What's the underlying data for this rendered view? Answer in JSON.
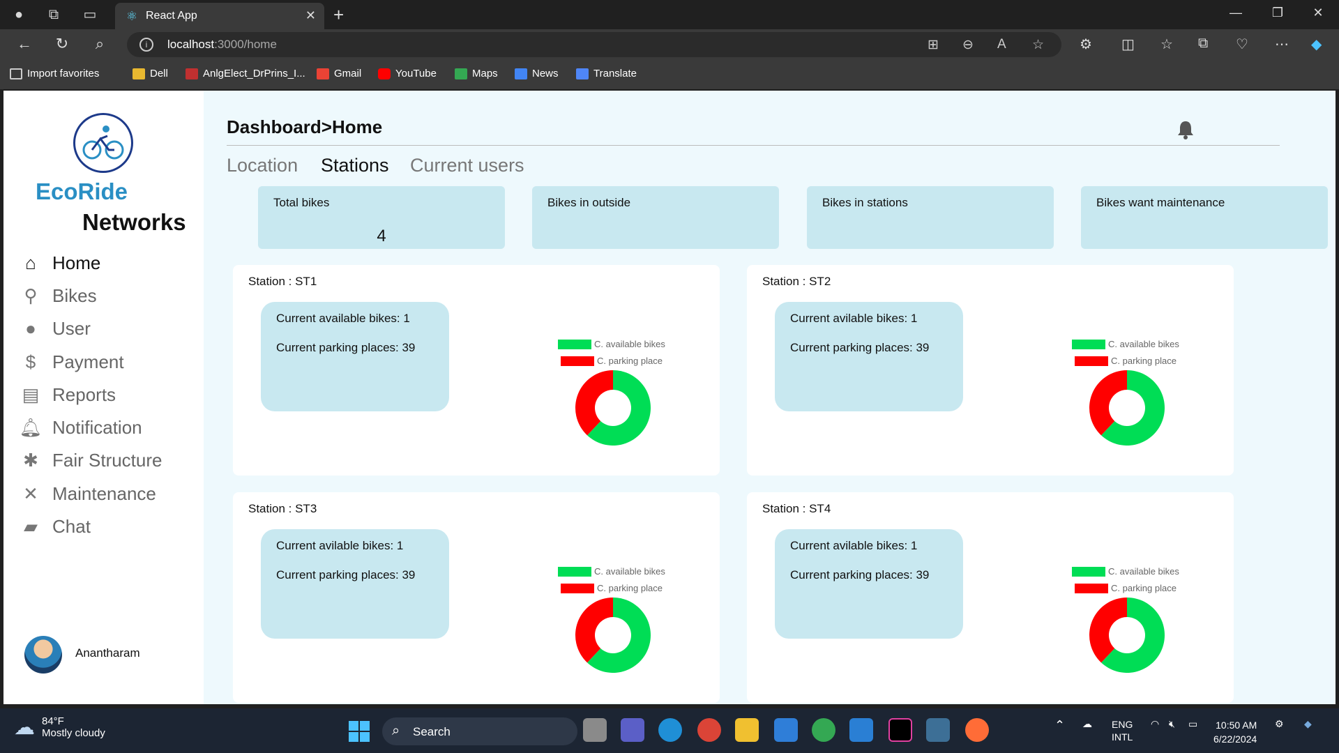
{
  "browser": {
    "tab_title": "React App",
    "url_host": "localhost",
    "url_path": ":3000/home",
    "bookmarks": [
      "Import favorites",
      "Dell",
      "AnlgElect_DrPrins_I...",
      "Gmail",
      "YouTube",
      "Maps",
      "News",
      "Translate"
    ]
  },
  "app": {
    "brand_line1": "EcoRide",
    "brand_line2": "Networks",
    "menu": [
      "Home",
      "Bikes",
      "User",
      "Payment",
      "Reports",
      "Notification",
      "Fair Structure",
      "Maintenance",
      "Chat"
    ],
    "active_menu": "Home",
    "user_name": "Anantharam",
    "breadcrumb": "Dashboard>Home",
    "subtabs": [
      "Location",
      "Stations",
      "Current users"
    ],
    "active_subtab": "Stations",
    "stats": [
      {
        "label": "Total bikes",
        "value": "4"
      },
      {
        "label": "Bikes in outside",
        "value": ""
      },
      {
        "label": "Bikes in stations",
        "value": ""
      },
      {
        "label": "Bikes want maintenance",
        "value": ""
      }
    ],
    "stations": [
      {
        "title": "Station : ST1",
        "line1": "Current available bikes:  1",
        "line2": "Current parking places:  39"
      },
      {
        "title": "Station : ST2",
        "line1": "Current avilable bikes:  1",
        "line2": "Current parking places:  39"
      },
      {
        "title": "Station : ST3",
        "line1": "Current avilable bikes:  1",
        "line2": "Current parking places:  39"
      },
      {
        "title": "Station : ST4",
        "line1": "Current avilable bikes:  1",
        "line2": "Current parking places:  39"
      }
    ],
    "legend": {
      "available": "C. available bikes",
      "parking": "C. parking place"
    },
    "colors": {
      "available": "#00dd55",
      "parking": "#ff0000",
      "card": "#c8e8f0",
      "bg": "#eef9fd",
      "brand": "#2a8fc4"
    }
  },
  "chart_data": [
    {
      "type": "pie",
      "title": "",
      "labels": [
        "C. available bikes",
        "C. parking place"
      ],
      "values": [
        62,
        38
      ]
    },
    {
      "type": "pie",
      "title": "",
      "labels": [
        "C. available bikes",
        "C. parking place"
      ],
      "values": [
        62,
        38
      ]
    },
    {
      "type": "pie",
      "title": "",
      "labels": [
        "C. available bikes",
        "C. parking place"
      ],
      "values": [
        62,
        38
      ]
    },
    {
      "type": "pie",
      "title": "",
      "labels": [
        "C. available bikes",
        "C. parking place"
      ],
      "values": [
        62,
        38
      ]
    }
  ],
  "taskbar": {
    "temp": "84°F",
    "weather": "Mostly cloudy",
    "search": "Search",
    "lang1": "ENG",
    "lang2": "INTL",
    "time": "10:50 AM",
    "date": "6/22/2024"
  }
}
